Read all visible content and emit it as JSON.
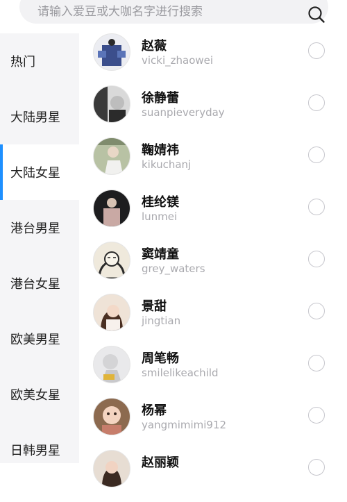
{
  "search": {
    "placeholder": "请输入爱豆或大咖名字进行搜索"
  },
  "categories": [
    {
      "label": "热门",
      "active": false
    },
    {
      "label": "大陆男星",
      "active": false
    },
    {
      "label": "大陆女星",
      "active": true
    },
    {
      "label": "港台男星",
      "active": false
    },
    {
      "label": "港台女星",
      "active": false
    },
    {
      "label": "欧美男星",
      "active": false
    },
    {
      "label": "欧美女星",
      "active": false
    },
    {
      "label": "日韩男星",
      "active": false
    }
  ],
  "stars": [
    {
      "name": "赵薇",
      "handle": "vicki_zhaowei",
      "selected": false
    },
    {
      "name": "徐静蕾",
      "handle": "suanpieveryday",
      "selected": false
    },
    {
      "name": "鞠婧祎",
      "handle": "kikuchanj",
      "selected": false
    },
    {
      "name": "桂纶镁",
      "handle": "lunmei",
      "selected": false
    },
    {
      "name": "窦靖童",
      "handle": "grey_waters",
      "selected": false
    },
    {
      "name": "景甜",
      "handle": "jingtian",
      "selected": false
    },
    {
      "name": "周笔畅",
      "handle": "smilelikeachild",
      "selected": false
    },
    {
      "name": "杨幂",
      "handle": "yangmimimi912",
      "selected": false
    },
    {
      "name": "赵丽颖",
      "handle": "",
      "selected": false
    }
  ],
  "colors": {
    "accent": "#1e90ff",
    "sidebar_bg": "#f5f5f7",
    "search_bg": "#f2f2f4"
  }
}
